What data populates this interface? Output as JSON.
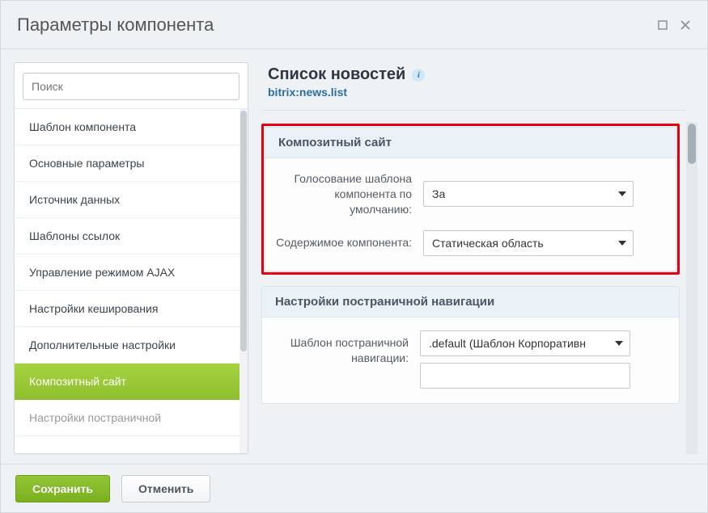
{
  "window": {
    "title": "Параметры компонента"
  },
  "search": {
    "placeholder": "Поиск"
  },
  "sidebar": {
    "items": [
      {
        "label": "Шаблон компонента",
        "active": false
      },
      {
        "label": "Основные параметры",
        "active": false
      },
      {
        "label": "Источник данных",
        "active": false
      },
      {
        "label": "Шаблоны ссылок",
        "active": false
      },
      {
        "label": "Управление режимом AJAX",
        "active": false
      },
      {
        "label": "Настройки кеширования",
        "active": false
      },
      {
        "label": "Дополнительные настройки",
        "active": false
      },
      {
        "label": "Композитный сайт",
        "active": true
      },
      {
        "label": "Настройки постраничной",
        "active": false,
        "partial": true
      }
    ]
  },
  "header": {
    "title": "Список новостей",
    "component": "bitrix:news.list",
    "info_glyph": "i"
  },
  "sections": {
    "composite": {
      "title": "Композитный сайт",
      "fields": {
        "vote": {
          "label": "Голосование шаблона компонента по умолчанию:",
          "value": "За"
        },
        "content": {
          "label": "Содержимое компонента:",
          "value": "Статическая область"
        }
      }
    },
    "pager": {
      "title": "Настройки постраничной навигации",
      "fields": {
        "template": {
          "label": "Шаблон постраничной навигации:",
          "value": ".default (Шаблон Корпоративн",
          "input_value": ""
        }
      }
    }
  },
  "footer": {
    "save": "Сохранить",
    "cancel": "Отменить"
  }
}
